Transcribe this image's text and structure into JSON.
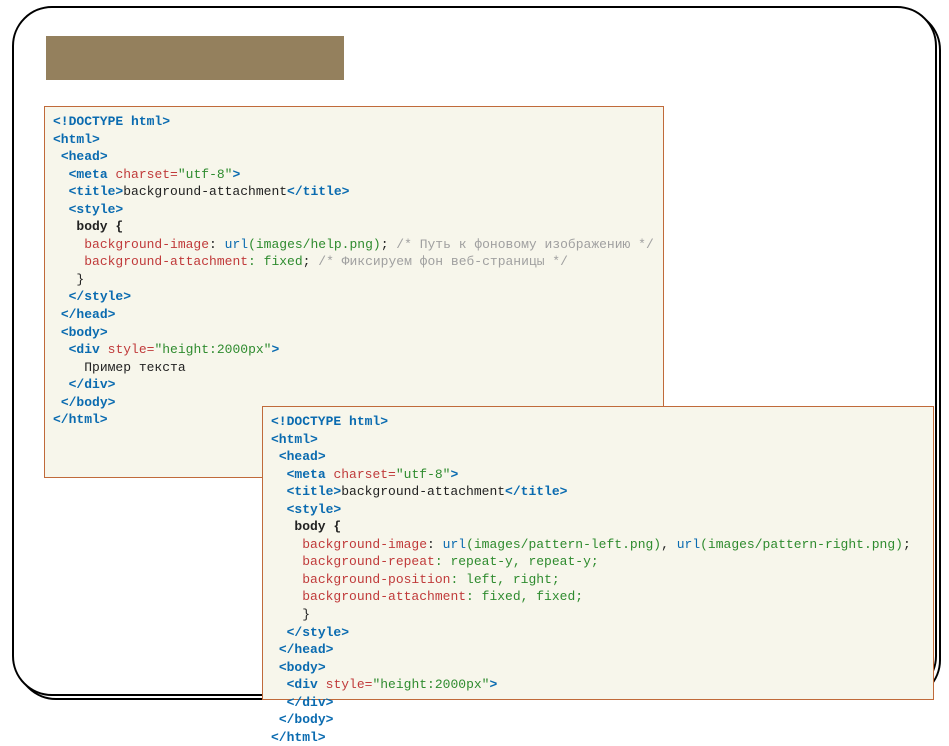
{
  "code1": {
    "doctype": "<!DOCTYPE html>",
    "html_open": "<html>",
    "head_open": "<head>",
    "meta_open": "<meta",
    "meta_attr": "charset=",
    "meta_val": "\"utf-8\"",
    "meta_close": ">",
    "title_open": "<title>",
    "title_text": "background-attachment",
    "title_close": "</title>",
    "style_open": "<style>",
    "body_sel": "body {",
    "bg_image_prop": "background-image",
    "bg_image_colon": ": ",
    "bg_image_url_a": "url",
    "bg_image_url_b": "(images/help.png)",
    "bg_image_semi": ";",
    "bg_image_cmt": " /* Путь к фоновому изображению */",
    "bg_attach_prop": "background-attachment",
    "bg_attach_val": ": fixed",
    "bg_attach_semi": ";",
    "bg_attach_cmt": " /* Фиксируем фон веб-страницы */",
    "brace_close": "}",
    "style_close": "</style>",
    "head_close": "</head>",
    "body_open": "<body>",
    "div_open": "<div",
    "div_attr": "style=",
    "div_val": "\"height:2000px\"",
    "div_close": ">",
    "div_text": "Пример текста",
    "div_end": "</div>",
    "body_close": "</body>",
    "html_close": "</html>"
  },
  "code2": {
    "doctype": "<!DOCTYPE html>",
    "html_open": "<html>",
    "head_open": "<head>",
    "meta_open": "<meta",
    "meta_attr": "charset=",
    "meta_val": "\"utf-8\"",
    "meta_close": ">",
    "title_open": "<title>",
    "title_text": "background-attachment",
    "title_close": "</title>",
    "style_open": "<style>",
    "body_sel": "body {",
    "bg_image_prop": "background-image",
    "bg_image_colon": ": ",
    "bg_image_url1a": "url",
    "bg_image_url1b": "(images/pattern-left.png)",
    "bg_image_comma": ", ",
    "bg_image_url2a": "url",
    "bg_image_url2b": "(images/pattern-right.png)",
    "bg_image_semi": ";",
    "bg_repeat_prop": "background-repeat",
    "bg_repeat_val": ": repeat-y, repeat-y;",
    "bg_pos_prop": "background-position",
    "bg_pos_val": ": left, right;",
    "bg_attach_prop": "background-attachment",
    "bg_attach_val": ": fixed, fixed;",
    "brace_close": "}",
    "style_close": "</style>",
    "head_close": "</head>",
    "body_open": "<body>",
    "div_open": "<div",
    "div_attr": "style=",
    "div_val": "\"height:2000px\"",
    "div_close": ">",
    "div_end": "</div>",
    "body_close": "</body>",
    "html_close": "</html>"
  }
}
